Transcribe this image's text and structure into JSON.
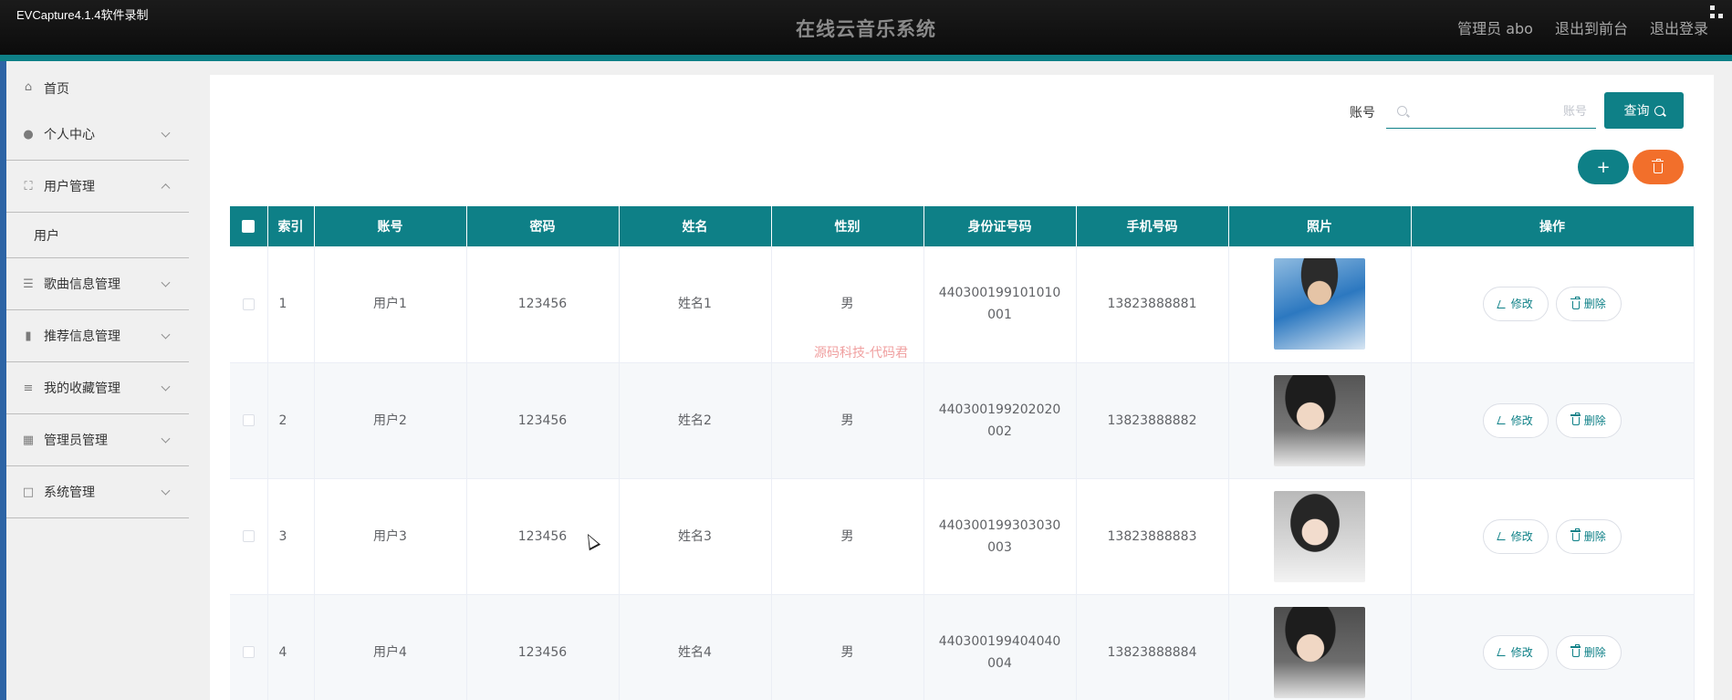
{
  "recorder_label": "EVCapture4.1.4软件录制",
  "app_title": "在线云音乐系统",
  "header": {
    "admin_label": "管理员 abo",
    "front_label": "退出到前台",
    "logout_label": "退出登录"
  },
  "sidebar": {
    "home": "首页",
    "personal": "个人中心",
    "user_mgmt": "用户管理",
    "user_sub": "用户",
    "song_mgmt": "歌曲信息管理",
    "recommend_mgmt": "推荐信息管理",
    "favorite_mgmt": "我的收藏管理",
    "admin_mgmt": "管理员管理",
    "system_mgmt": "系统管理"
  },
  "search": {
    "label": "账号",
    "placeholder": "账号",
    "value": "",
    "button": "查询"
  },
  "actions": {
    "add": "+"
  },
  "table": {
    "headers": {
      "index": "索引",
      "account": "账号",
      "password": "密码",
      "name": "姓名",
      "gender": "性别",
      "idcard": "身份证号码",
      "phone": "手机号码",
      "photo": "照片",
      "ops": "操作"
    },
    "edit_label": "修改",
    "delete_label": "删除",
    "rows": [
      {
        "index": "1",
        "account": "用户1",
        "password": "123456",
        "name": "姓名1",
        "gender": "男",
        "idcard": "440300199101010001",
        "phone": "13823888881"
      },
      {
        "index": "2",
        "account": "用户2",
        "password": "123456",
        "name": "姓名2",
        "gender": "男",
        "idcard": "440300199202020002",
        "phone": "13823888882"
      },
      {
        "index": "3",
        "account": "用户3",
        "password": "123456",
        "name": "姓名3",
        "gender": "男",
        "idcard": "440300199303030003",
        "phone": "13823888883"
      },
      {
        "index": "4",
        "account": "用户4",
        "password": "123456",
        "name": "姓名4",
        "gender": "男",
        "idcard": "440300199404040004",
        "phone": "13823888884"
      }
    ]
  },
  "watermark": "源码科技-代码君",
  "colors": {
    "primary": "#0e8087",
    "danger": "#f26f2b",
    "header_bg": "#111111"
  }
}
